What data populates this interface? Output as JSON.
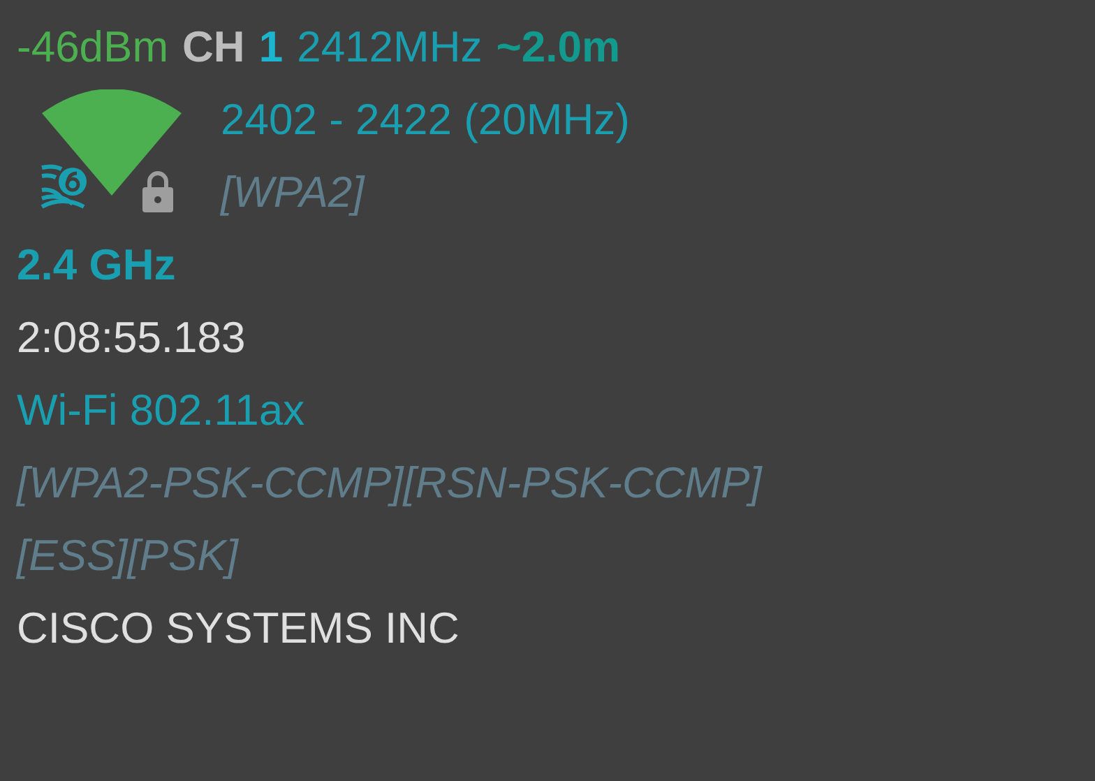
{
  "signal": "-46dBm",
  "channel_label": "CH",
  "channel": "1",
  "frequency": "2412MHz",
  "distance": "~2.0m",
  "range": "2402 - 2422 (20MHz)",
  "security": "[WPA2]",
  "band": "2.4 GHz",
  "time": "2:08:55.183",
  "standard": "Wi-Fi 802.11ax",
  "capabilities": "[WPA2-PSK-CCMP][RSN-PSK-CCMP][ESS][PSK]",
  "vendor": "CISCO SYSTEMS INC"
}
